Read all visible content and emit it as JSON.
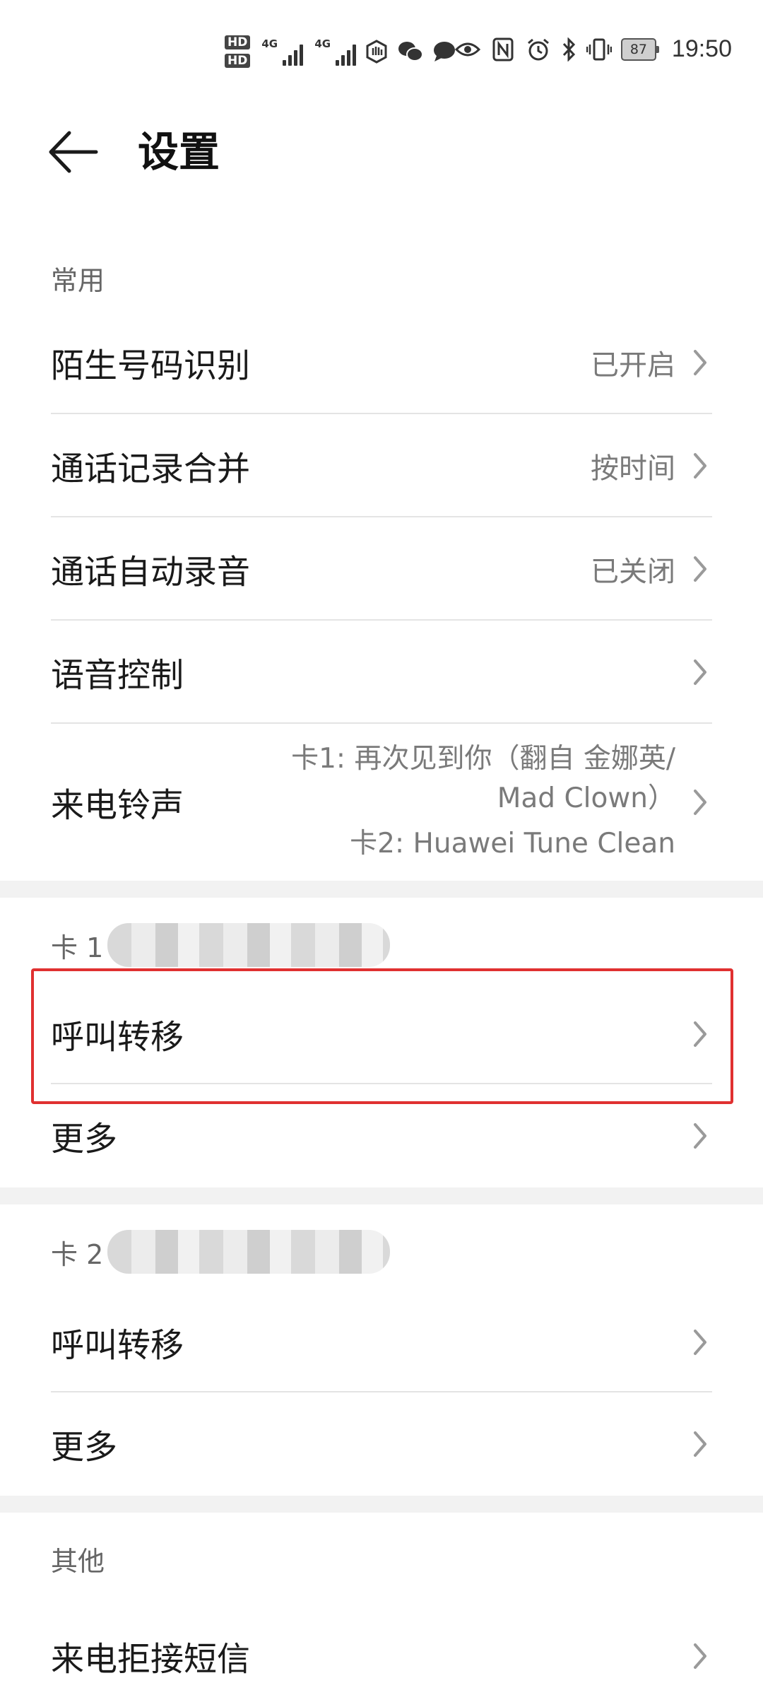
{
  "status_bar": {
    "hd1": "HD",
    "hd2": "HD",
    "sig1_label": "4G",
    "sig2_label": "4G",
    "battery": "87",
    "time": "19:50"
  },
  "header": {
    "title": "设置"
  },
  "sections": {
    "common": {
      "header": "常用",
      "rows": [
        {
          "label": "陌生号码识别",
          "value": "已开启"
        },
        {
          "label": "通话记录合并",
          "value": "按时间"
        },
        {
          "label": "通话自动录音",
          "value": "已关闭"
        },
        {
          "label": "语音控制",
          "value": ""
        },
        {
          "label": "来电铃声",
          "value_line1": "卡1: 再次见到你（翻自 金娜英/",
          "value_line2": "Mad Clown）",
          "value_line3": "卡2: Huawei Tune Clean"
        }
      ]
    },
    "card1": {
      "header": "卡 1",
      "rows": [
        {
          "label": "呼叫转移"
        },
        {
          "label": "更多"
        }
      ]
    },
    "card2": {
      "header": "卡 2",
      "rows": [
        {
          "label": "呼叫转移"
        },
        {
          "label": "更多"
        }
      ]
    },
    "other": {
      "header": "其他",
      "rows": [
        {
          "label": "来电拒接短信"
        }
      ]
    }
  },
  "colors": {
    "highlight": "#e03030",
    "divider": "#e4e4e4",
    "gap": "#f2f2f2"
  }
}
